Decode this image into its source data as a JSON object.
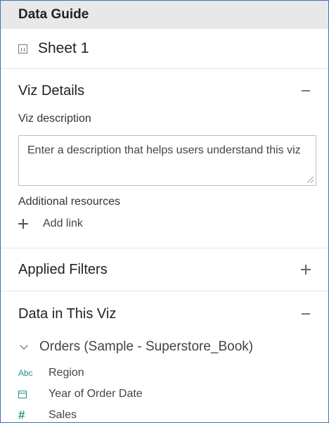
{
  "header": {
    "title": "Data Guide"
  },
  "sheet": {
    "title": "Sheet 1",
    "icon": "sheet-icon"
  },
  "viz_details": {
    "title": "Viz Details",
    "toggle": "minus",
    "description_label": "Viz description",
    "description_placeholder": "Enter a description that helps users understand this viz",
    "resources_label": "Additional resources",
    "add_link_label": "Add link"
  },
  "applied_filters": {
    "title": "Applied Filters",
    "toggle": "plus"
  },
  "data_in_viz": {
    "title": "Data in This Viz",
    "toggle": "minus",
    "source": "Orders (Sample - Superstore_Book)",
    "fields": [
      {
        "type": "Abc",
        "icon": "string-type-icon",
        "label": "Region"
      },
      {
        "type": "date",
        "icon": "calendar-icon",
        "label": "Year of Order Date"
      },
      {
        "type": "#",
        "icon": "number-type-icon",
        "label": "Sales"
      }
    ]
  },
  "colors": {
    "border": "#3a6fc4",
    "header_bg": "#e8e8e8",
    "field_icon": "#2a8f8f",
    "number_icon": "#2a9a6a"
  }
}
